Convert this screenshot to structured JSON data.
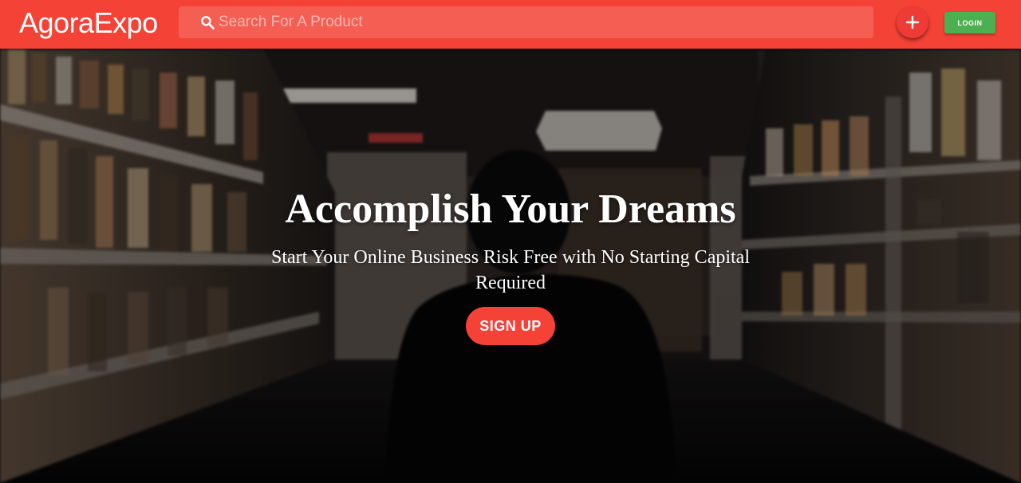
{
  "app": {
    "brand": "AgoraExpo"
  },
  "search": {
    "placeholder": "Search For A Product",
    "value": ""
  },
  "toolbar": {
    "add_icon": "plus-icon",
    "login_label": "LOGIN"
  },
  "hero": {
    "title": "Accomplish Your Dreams",
    "subtitle": "Start Your Online Business Risk Free with No Starting Capital Required",
    "signup_label": "SIGN UP"
  },
  "colors": {
    "primary": "#f44336",
    "login": "#4caf50",
    "text": "#ffffff"
  }
}
